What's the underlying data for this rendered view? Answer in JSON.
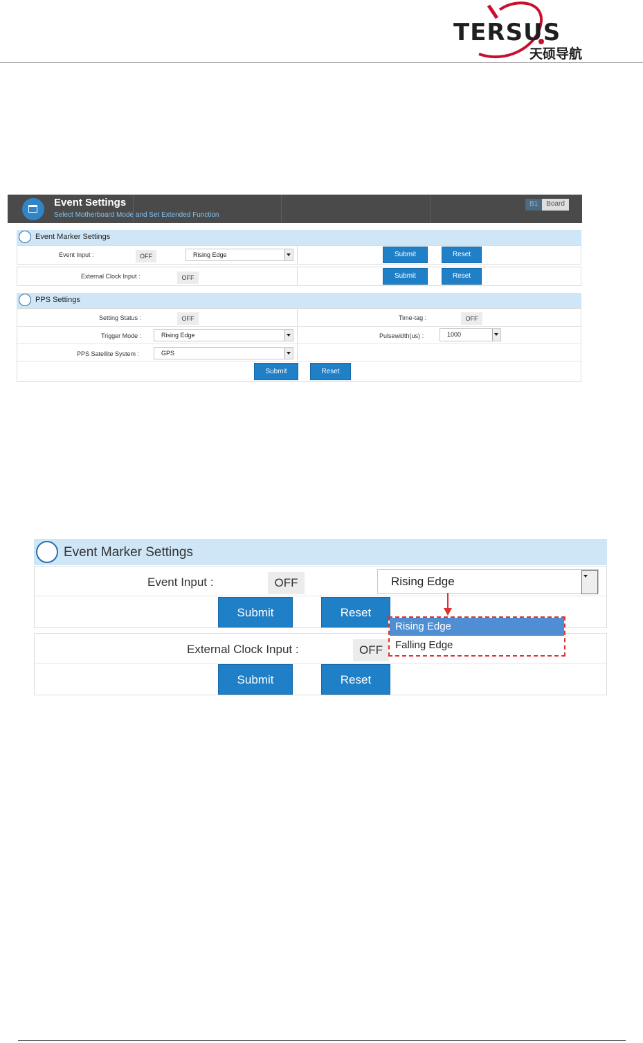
{
  "brand": {
    "name": "TERSUS",
    "name_cn": "天硕导航"
  },
  "panel": {
    "title": "Event Settings",
    "subtitle": "Select Motherboard Mode and Set Extended Function",
    "badge_left": "B1",
    "badge_right": "Board"
  },
  "event_marker": {
    "heading": "Event Marker Settings",
    "event_input_label": "Event Input  :",
    "event_input_value": "OFF",
    "edge_value": "Rising Edge",
    "external_clock_label": "External Clock Input  :",
    "external_clock_value": "OFF",
    "submit": "Submit",
    "reset": "Reset"
  },
  "pps": {
    "heading": "PPS Settings",
    "setting_status_label": "Setting Status  :",
    "setting_status_value": "OFF",
    "trigger_mode_label": "Trigger Mode  :",
    "trigger_mode_value": "Rising Edge",
    "satellite_label": "PPS Satellite System  :",
    "satellite_value": "GPS",
    "time_tag_label": "Time-tag  :",
    "time_tag_value": "OFF",
    "pulsewidth_label": "Pulsewidth(us)  :",
    "pulsewidth_value": "1000",
    "submit": "Submit",
    "reset": "Reset"
  },
  "zoom": {
    "heading": "Event Marker Settings",
    "event_input_label": "Event Input  :",
    "event_input_value": "OFF",
    "edge_value": "Rising Edge",
    "external_clock_label": "External Clock Input  :",
    "external_clock_value": "OFF",
    "submit": "Submit",
    "reset": "Reset",
    "options": [
      "Rising Edge",
      "Falling Edge"
    ]
  },
  "colors": {
    "accent": "#1f7fc7",
    "highlight": "#e03030",
    "section_bg": "#cfe6f7"
  }
}
